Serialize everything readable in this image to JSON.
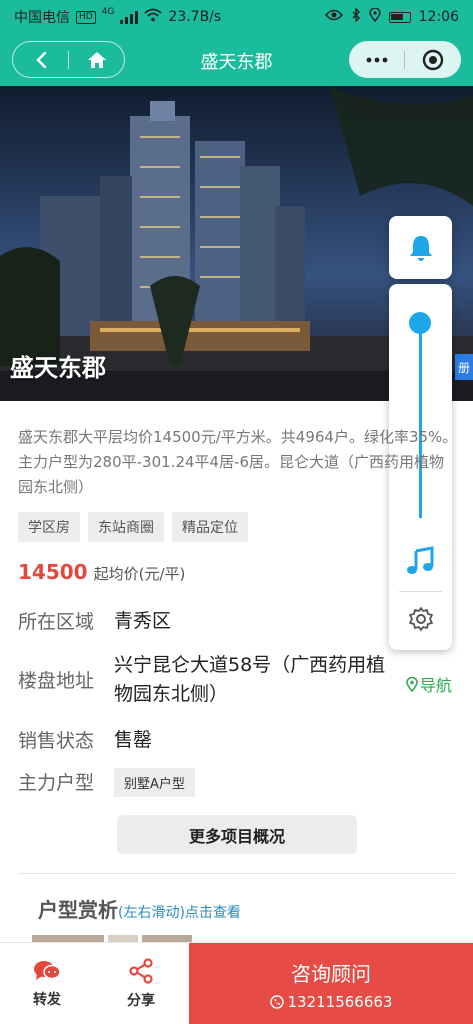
{
  "status_bar": {
    "carrier": "中国电信",
    "network_badge": "HD",
    "network_gen": "4G",
    "speed": "23.7B/s",
    "time": "12:06"
  },
  "nav": {
    "title": "盛天东郡",
    "accent_color": "#1abc9c"
  },
  "hero": {
    "title": "盛天东郡",
    "side_tab_text": "册"
  },
  "project": {
    "description": "盛天东郡大平层均价14500元/平方米。共4964户。绿化率35%。主力户型为280平-301.24平4居-6居。昆仑大道（广西药用植物园东北侧）",
    "tags": [
      "学区房",
      "东站商圈",
      "精品定位"
    ],
    "price": "14500",
    "price_unit": "起均价(元/平)"
  },
  "info": {
    "region_label": "所在区域",
    "region_value": "青秀区",
    "address_label": "楼盘地址",
    "address_value": "兴宁昆仑大道58号（广西药用植物园东北侧）",
    "navigate": "导航",
    "status_label": "销售状态",
    "status_value": "售罄",
    "type_label": "主力户型",
    "type_value": "别墅A户型"
  },
  "more_button": "更多项目概况",
  "floor_plan": {
    "title": "户型赏析",
    "hint": "(左右滑动)点击查看"
  },
  "bottom_bar": {
    "forward": "转发",
    "share": "分享",
    "consult": "咨询顾问",
    "phone": "13211566663",
    "consult_color": "#e64b45"
  }
}
